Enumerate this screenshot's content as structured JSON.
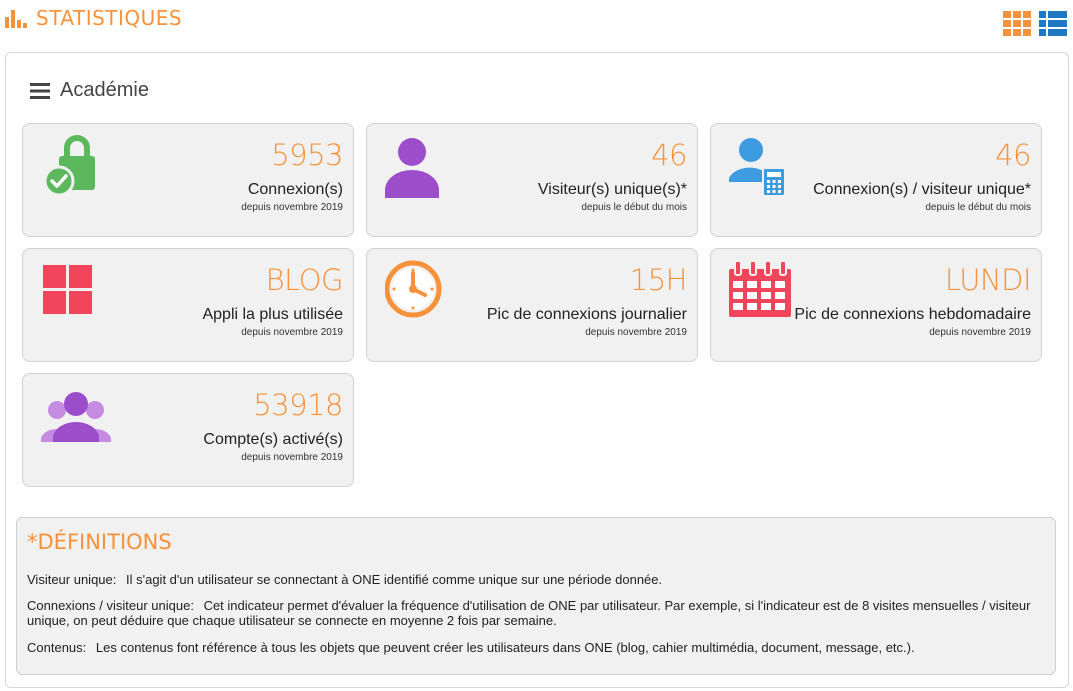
{
  "header": {
    "title": "STATISTIQUES",
    "title_icon": "bar-chart-icon",
    "view_buttons": [
      {
        "icon": "grid-view-icon"
      },
      {
        "icon": "list-view-icon"
      }
    ]
  },
  "section": {
    "title": "Académie",
    "icon": "hamburger-icon"
  },
  "cards": [
    {
      "icon": "lock-check-icon",
      "value": "5953",
      "label": "Connexion(s)",
      "sub": "depuis novembre 2019"
    },
    {
      "icon": "user-icon",
      "value": "46",
      "label": "Visiteur(s) unique(s)*",
      "sub": "depuis le début du mois"
    },
    {
      "icon": "user-calculator-icon",
      "value": "46",
      "label": "Connexion(s) / visiteur unique*",
      "sub": "depuis le début du mois"
    },
    {
      "icon": "app-grid-icon",
      "value": "BLOG",
      "label": "Appli la plus utilisée",
      "sub": "depuis novembre 2019"
    },
    {
      "icon": "clock-icon",
      "value": "15H",
      "label": "Pic de connexions journalier",
      "sub": "depuis novembre 2019"
    },
    {
      "icon": "calendar-icon",
      "value": "LUNDI",
      "label": "Pic de connexions hebdomadaire",
      "sub": "depuis novembre 2019"
    },
    {
      "icon": "users-group-icon",
      "value": "53918",
      "label": "Compte(s) activé(s)",
      "sub": "depuis novembre 2019"
    }
  ],
  "definitions": {
    "title": "*DÉFINITIONS",
    "items": [
      {
        "term": "Visiteur unique:",
        "text": "Il s'agit d'un utilisateur se connectant à ONE identifié comme unique sur une période donnée."
      },
      {
        "term": "Connexions / visiteur unique:",
        "text": "Cet indicateur permet d'évaluer la fréquence d'utilisation de ONE par utilisateur. Par exemple, si l'indicateur est de 8 visites mensuelles / visiteur unique, on peut déduire que chaque utilisateur se connecte en moyenne 2 fois par semaine."
      },
      {
        "term": "Contenus:",
        "text": "Les contenus font référence à tous les objets que peuvent créer les utilisateurs dans ONE (blog, cahier multimédia, document, message, etc.)."
      }
    ]
  },
  "colors": {
    "accent": "#f7923a",
    "green": "#5cb85c",
    "purple": "#9b4dca",
    "blue": "#3d9be0",
    "red": "#f0455a",
    "orange": "#f7923a",
    "list_blue": "#1f78c1"
  }
}
